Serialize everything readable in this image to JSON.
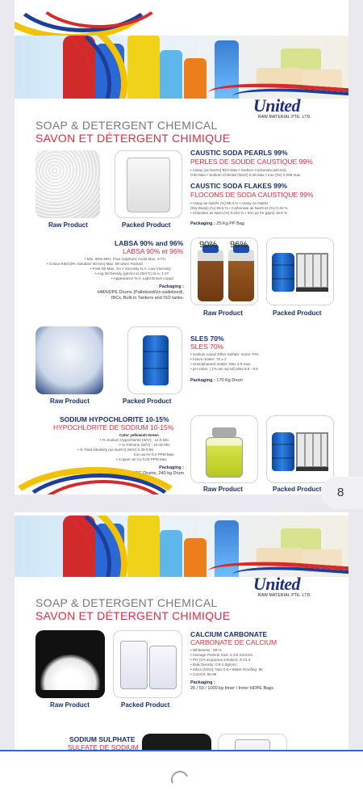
{
  "page_number": "8",
  "brand": {
    "name": "United",
    "subtitle": "RAW MATERIAL PTE. LTD."
  },
  "section": {
    "title_en": "SOAP & DETERGENT CHEMICAL",
    "title_fr": "SAVON ET DÉTERGENT CHIMIQUE"
  },
  "caustic": {
    "pearls_title": "CAUSTIC SODA PEARLS 99%",
    "pearls_sub": "PERLES DE SOUDE CAUSTIQUE 99%",
    "pearls_spec1": "• Assay (as NaOH) 99.0 Max • Sodium Carbonate a2CO3):",
    "pearls_spec2": "0.80 Max • Sodium Chloride (NaCl) 0.05 Max • Iron (Fe) 0.008 max",
    "flakes_title": "CAUSTIC SODA FLAKES 99%",
    "flakes_sub": "FLOCONS DE SODA CAUSTIQUE 99%",
    "flakes_spec1": "• Assay as NaOH (%) 98.3 % • Assay on NaOH",
    "flakes_spec2": "(Dry Basis) (%) 99.5 % • Carbonate as Na2Co3 (%) 0.43 %",
    "flakes_spec3": "• Chlorides as NaCl (%) 0.044 % • Iron as Fe (ppm) 15.8 %",
    "packaging_label": "Packaging :",
    "packaging_value": "25 Kg PP Bag",
    "raw_caption": "Raw Product",
    "packed_caption": "Packed Product"
  },
  "labsa": {
    "title": "LABSA 90% and 96%",
    "sub": "LABSA 90% et 96%",
    "spec1": "• Min. 90% 96%, Free Sulphuric Acids Max. 4-7%",
    "spec2": "• Colour Klett (5% Solution/ 40 mm) Max. 50 when Packed",
    "spec3": "• Free Oil Max. 1% • Viscosity N.A. Low Viscosity",
    "spec4": "• Avg 30 Density (gm/ml at 20/4°C) N.A. 1.07",
    "spec5": "• Appearance N.A. Light Brown Liquid",
    "packaging_label": "Packaging :",
    "packaging_value1": "HM/HDPE Drums (Palletized/Un-palletized),",
    "packaging_value2": "IBCs, Bulk in Tankers and ISO tanks.",
    "bottle_label_1": "90%",
    "bottle_label_2": "96%",
    "raw_caption": "Raw Product",
    "packed_caption": "Packed Product"
  },
  "sles": {
    "title": "SLES 70%",
    "sub": "SLES 70%",
    "spec1": "• Sodium Lauryl Ether Sulfate: SLES 70%",
    "spec2": "• Active matter: 70 ± 2",
    "spec3": "• Unsulphanted matter: Max 3.5 max",
    "spec4": "• pH value, ( 1% am aq sol) Max 6.5 - 9.5",
    "packaging_label": "Packaging :",
    "packaging_value": "170 Kg Drum",
    "raw_caption": "Raw Product",
    "packed_caption": "Packed Product"
  },
  "hypo": {
    "title": "SODIUM HYPOCHLORITE 10-15%",
    "sub": "HYPOCHLORITE DE SODIUM 10-15%",
    "color": "Color yellowish-Green",
    "spec1": "• % Sodium Hypochlorite (W/V) : 12.6 Min",
    "spec2": "• % Chlorine (W/V) : 10-15 Min",
    "spec3": "• % Total Alkalinity (as NaOH) (W/V) 0.30-0.65",
    "spec4": "Iron as Fe 0.4 PPM Max",
    "spec5": "• Copper as Cu 0.03 PPM Max",
    "packaging_label": "Packaging :",
    "packaging_value": "1200 kg IBC Drums, 240 kg Drum",
    "raw_caption": "Raw Product",
    "packed_caption": "Packed Product"
  },
  "calcium": {
    "title": "CALCIUM CARBONATE",
    "sub": "CARBONATE DE CALCIUM",
    "spec1": "• Whiteness : 99 %",
    "spec2": "• Average Particle Size: 2-3.5 microns,",
    "spec3": "• PH (1% acqueous solution): 9-10.2",
    "spec4": "• Bulk Density: 0.8-1.0gm/cc,",
    "spec5": "• Silica (SiO2): Max 0.5 • Water Proofing: 95",
    "spec6": "• CaCO3: 96.98",
    "packaging_label": "Packaging :",
    "packaging_value": "25 / 50 / 1000 kg Inner / Inner HDPE Bags",
    "raw_caption": "Raw Product",
    "packed_caption": "Packed Product"
  },
  "sulphate": {
    "title": "SODIUM SULPHATE",
    "sub": "SULFATE DE SODIUM"
  }
}
